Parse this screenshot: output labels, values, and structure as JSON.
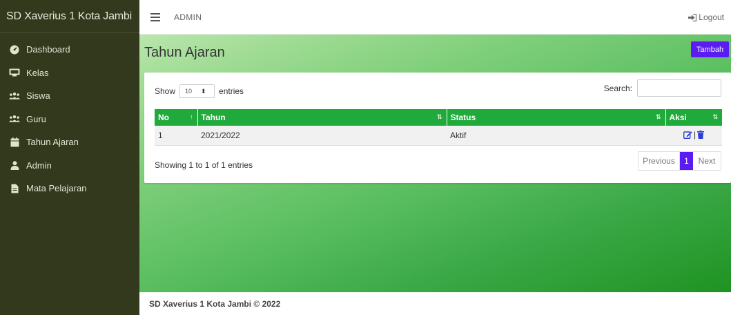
{
  "app": {
    "brand": "SD Xaverius 1 Kota Jambi"
  },
  "sidebar": {
    "items": [
      {
        "label": "Dashboard",
        "icon": "dashboard-icon"
      },
      {
        "label": "Kelas",
        "icon": "chalkboard-icon"
      },
      {
        "label": "Siswa",
        "icon": "users-icon"
      },
      {
        "label": "Guru",
        "icon": "users-icon"
      },
      {
        "label": "Tahun Ajaran",
        "icon": "calendar-icon"
      },
      {
        "label": "Admin",
        "icon": "user-icon"
      },
      {
        "label": "Mata Pelajaran",
        "icon": "file-icon"
      }
    ]
  },
  "topbar": {
    "role": "ADMIN",
    "logout_label": "Logout"
  },
  "page": {
    "title": "Tahun Ajaran",
    "add_button": "Tambah"
  },
  "table_controls": {
    "show_label": "Show",
    "length_value": "10",
    "entries_label": "entries",
    "search_label": "Search:",
    "search_value": ""
  },
  "table": {
    "columns": [
      "No",
      "Tahun",
      "Status",
      "Aksi"
    ],
    "rows": [
      {
        "no": "1",
        "tahun": "2021/2022",
        "status": "Aktif"
      }
    ]
  },
  "pagination": {
    "info": "Showing 1 to 1 of 1 entries",
    "prev": "Previous",
    "current": "1",
    "next": "Next"
  },
  "footer": {
    "text": "SD Xaverius 1 Kota Jambi © 2022"
  },
  "colors": {
    "sidebar_bg": "#33391c",
    "accent_purple": "#5a1cf0",
    "table_header_green": "#1faa3b",
    "action_icon_blue": "#2a3fd8"
  }
}
